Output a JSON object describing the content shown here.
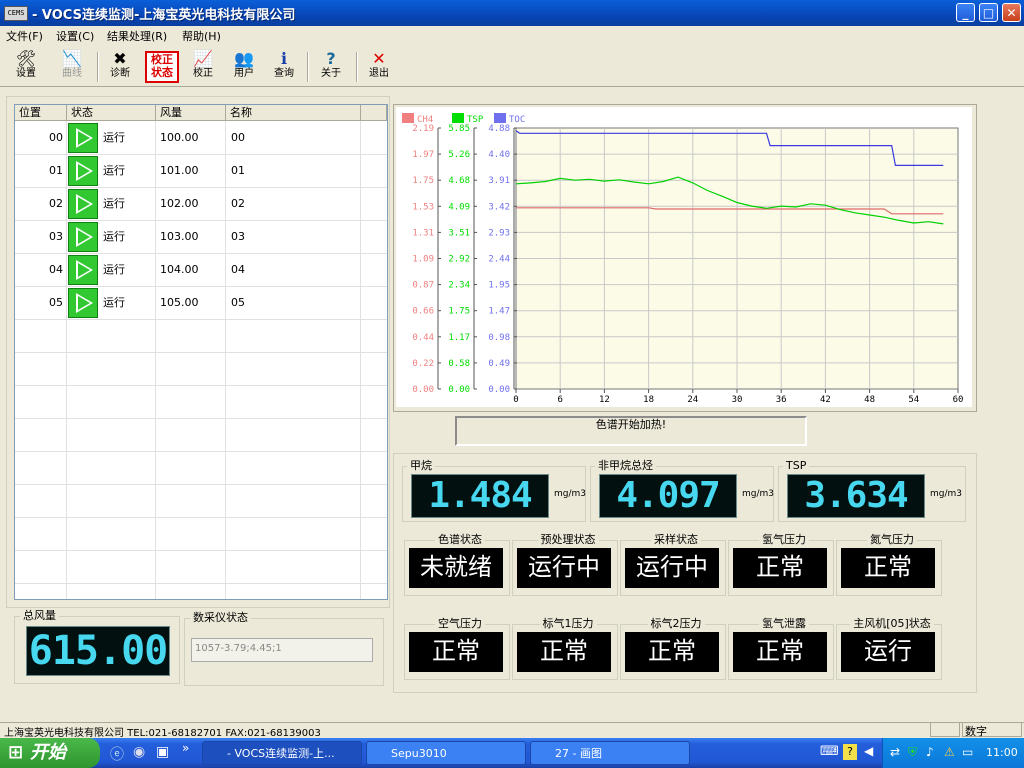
{
  "window": {
    "title": "- VOCS连续监测-上海宝英光电科技有限公司",
    "icon_text": "CEMS",
    "min": "_",
    "max": "□",
    "close": "✕"
  },
  "menu": [
    "文件(F)",
    "设置(C)",
    "结果处理(R)",
    "帮助(H)"
  ],
  "toolbar": {
    "settings": "设置",
    "curve": "曲线",
    "diagnose": "诊断",
    "calib_status": "校正状态",
    "calib_status_l1": "校正",
    "calib_status_l2": "状态",
    "calibrate": "校正",
    "user": "用户",
    "query": "查询",
    "about": "关于",
    "exit": "退出"
  },
  "table": {
    "headers": [
      "位置",
      "状态",
      "风量",
      "名称"
    ],
    "rows": [
      {
        "pos": "00",
        "state": "运行",
        "flow": "100.00",
        "name": "00"
      },
      {
        "pos": "01",
        "state": "运行",
        "flow": "101.00",
        "name": "01"
      },
      {
        "pos": "02",
        "state": "运行",
        "flow": "102.00",
        "name": "02"
      },
      {
        "pos": "03",
        "state": "运行",
        "flow": "103.00",
        "name": "03"
      },
      {
        "pos": "04",
        "state": "运行",
        "flow": "104.00",
        "name": "04"
      },
      {
        "pos": "05",
        "state": "运行",
        "flow": "105.00",
        "name": "05"
      }
    ]
  },
  "total_flow": {
    "label": "总风量",
    "value": "615.00"
  },
  "daq": {
    "label": "数采仪状态",
    "value": "1057-3.79;4.45;1"
  },
  "chart_data": {
    "type": "line",
    "x_ticks": [
      0,
      6,
      12,
      18,
      24,
      30,
      36,
      42,
      48,
      54,
      60
    ],
    "xlim": [
      0,
      60
    ],
    "axes": [
      {
        "name": "CH4",
        "color": "#f08080",
        "ticks": [
          "0.00",
          "0.22",
          "0.44",
          "0.66",
          "0.87",
          "1.09",
          "1.31",
          "1.53",
          "1.75",
          "1.97",
          "2.19"
        ],
        "ylim": [
          0,
          2.19
        ]
      },
      {
        "name": "TSP",
        "color": "#00dd00",
        "ticks": [
          "0.00",
          "0.58",
          "1.17",
          "1.75",
          "2.34",
          "2.92",
          "3.51",
          "4.09",
          "4.68",
          "5.26",
          "5.85"
        ],
        "ylim": [
          0,
          5.85
        ]
      },
      {
        "name": "TOC",
        "color": "#7070ee",
        "ticks": [
          "0.00",
          "0.49",
          "0.98",
          "1.47",
          "1.95",
          "2.44",
          "2.93",
          "3.42",
          "3.91",
          "4.40",
          "4.88"
        ],
        "ylim": [
          0,
          4.88
        ]
      }
    ],
    "series": [
      {
        "name": "CH4",
        "color": "#e06a6a",
        "axis": 0,
        "x": [
          0,
          18,
          19,
          50,
          51,
          58
        ],
        "y": [
          1.52,
          1.52,
          1.51,
          1.51,
          1.47,
          1.47
        ]
      },
      {
        "name": "TSP",
        "color": "#00d000",
        "axis": 1,
        "x": [
          0,
          2,
          4,
          6,
          8,
          10,
          12,
          14,
          16,
          18,
          20,
          22,
          24,
          26,
          28,
          30,
          32,
          34,
          36,
          38,
          40,
          42,
          44,
          46,
          48,
          50,
          52,
          54,
          56,
          58
        ],
        "y": [
          4.6,
          4.62,
          4.65,
          4.72,
          4.68,
          4.7,
          4.66,
          4.69,
          4.64,
          4.6,
          4.65,
          4.75,
          4.62,
          4.45,
          4.32,
          4.18,
          4.1,
          4.05,
          4.1,
          4.08,
          4.15,
          4.12,
          4.02,
          3.95,
          3.9,
          3.85,
          3.78,
          3.72,
          3.75,
          3.7
        ]
      },
      {
        "name": "TOC",
        "color": "#3a3ae0",
        "axis": 2,
        "x": [
          0,
          0.5,
          34,
          34.5,
          51,
          51.5,
          58
        ],
        "y": [
          4.83,
          4.78,
          4.78,
          4.55,
          4.55,
          4.18,
          4.18
        ]
      }
    ]
  },
  "status_message": "色谱开始加热!",
  "readings": [
    {
      "label": "甲烷",
      "value": "1.484",
      "unit": "mg/m3"
    },
    {
      "label": "非甲烷总烃",
      "value": "4.097",
      "unit": "mg/m3"
    },
    {
      "label": "TSP",
      "value": "3.634",
      "unit": "mg/m3"
    }
  ],
  "status_row1": [
    {
      "label": "色谱状态",
      "value": "未就绪"
    },
    {
      "label": "预处理状态",
      "value": "运行中"
    },
    {
      "label": "采样状态",
      "value": "运行中"
    },
    {
      "label": "氢气压力",
      "value": "正常"
    },
    {
      "label": "氮气压力",
      "value": "正常"
    }
  ],
  "status_row2": [
    {
      "label": "空气压力",
      "value": "正常"
    },
    {
      "label": "标气1压力",
      "value": "正常"
    },
    {
      "label": "标气2压力",
      "value": "正常"
    },
    {
      "label": "氢气泄露",
      "value": "正常"
    },
    {
      "label": "主风机[05]状态",
      "value": "运行"
    }
  ],
  "statusbar": {
    "company": "上海宝英光电科技有限公司 TEL:021-68182701 FAX:021-68139003",
    "mode": "数字"
  },
  "taskbar": {
    "start": "开始",
    "more": "»",
    "tasks": [
      "- VOCS连续监测-上...",
      "Sepu3010",
      "27 - 画图"
    ],
    "clock": "11:00"
  },
  "colors": {
    "lcd_text": "#47d8f0",
    "run_green": "#31c831",
    "titlebar": "#0846b8"
  }
}
